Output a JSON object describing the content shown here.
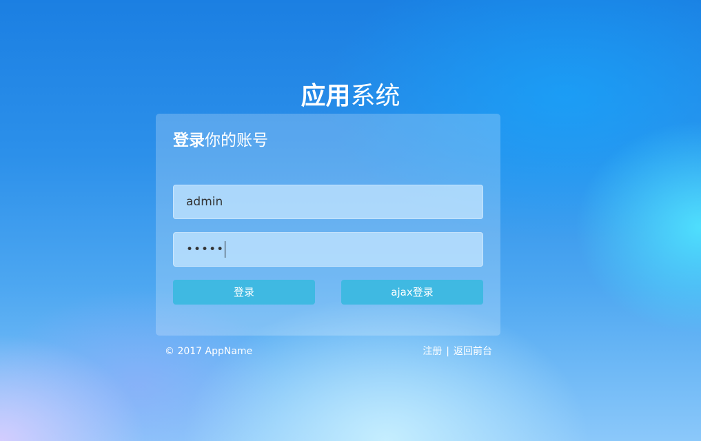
{
  "app": {
    "title_strong": "应用",
    "title_light": "系统"
  },
  "login": {
    "heading_strong": "登录",
    "heading_light": "你的账号",
    "username_value": "admin",
    "password_value": "•••••",
    "login_button": "登录",
    "ajax_login_button": "ajax登录"
  },
  "footer": {
    "copyright": "© 2017 AppName",
    "register_link": "注册",
    "separator": "|",
    "back_link": "返回前台"
  }
}
